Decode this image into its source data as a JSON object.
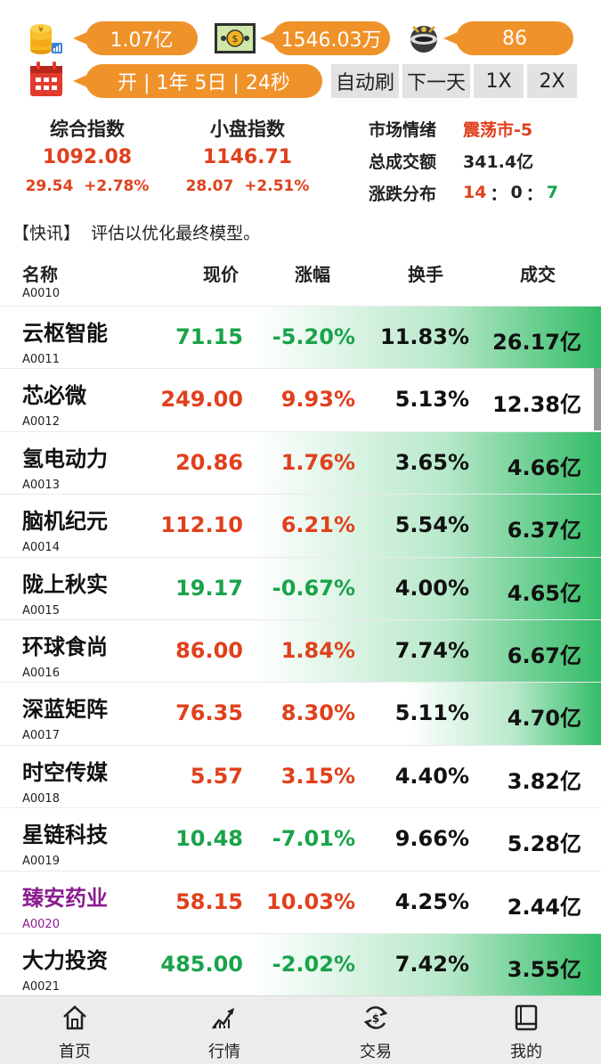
{
  "status": {
    "cash": "1.07亿",
    "assets": "1546.03万",
    "score": "86",
    "session": "开 | 1年 5日 | 24秒"
  },
  "controls": {
    "auto_refresh": "自动刷",
    "next_day": "下一天",
    "speed_1x": "1X",
    "speed_2x": "2X"
  },
  "indices": [
    {
      "name": "综合指数",
      "value": "1092.08",
      "change": "29.54",
      "pct": "+2.78%"
    },
    {
      "name": "小盘指数",
      "value": "1146.71",
      "change": "28.07",
      "pct": "+2.51%"
    }
  ],
  "market": {
    "sentiment_label": "市场情绪",
    "sentiment_value": "震荡市-5",
    "volume_label": "总成交额",
    "volume_value": "341.4亿",
    "dist_label": "涨跌分布",
    "dist_up": "14",
    "dist_flat": "0",
    "dist_down": "7",
    "dist_sep1": "：",
    "dist_sep2": "："
  },
  "news": {
    "tag": "【快讯】",
    "text": "评估以优化最终模型。"
  },
  "table": {
    "headers": {
      "name": "名称",
      "price": "现价",
      "change": "涨幅",
      "turnover": "换手",
      "volume": "成交"
    },
    "first_code": "A0010",
    "rows": [
      {
        "name": "云枢智能",
        "code": "A0011",
        "price": "71.15",
        "change": "-5.20%",
        "turnover": "11.83%",
        "volume": "26.17亿",
        "dir": "down",
        "bar_level": 0.58
      },
      {
        "name": "芯必微",
        "code": "A0012",
        "price": "249.00",
        "change": "9.93%",
        "turnover": "5.13%",
        "volume": "12.38亿",
        "dir": "up",
        "bar_level": 0
      },
      {
        "name": "氢电动力",
        "code": "A0013",
        "price": "20.86",
        "change": "1.76%",
        "turnover": "3.65%",
        "volume": "4.66亿",
        "dir": "up",
        "bar_level": 0.58
      },
      {
        "name": "脑机纪元",
        "code": "A0014",
        "price": "112.10",
        "change": "6.21%",
        "turnover": "5.54%",
        "volume": "6.37亿",
        "dir": "up",
        "bar_level": 0.58
      },
      {
        "name": "陇上秋实",
        "code": "A0015",
        "price": "19.17",
        "change": "-0.67%",
        "turnover": "4.00%",
        "volume": "4.65亿",
        "dir": "down",
        "bar_level": 0.58
      },
      {
        "name": "环球食尚",
        "code": "A0016",
        "price": "86.00",
        "change": "1.84%",
        "turnover": "7.74%",
        "volume": "6.67亿",
        "dir": "up",
        "bar_level": 0.58
      },
      {
        "name": "深蓝矩阵",
        "code": "A0017",
        "price": "76.35",
        "change": "8.30%",
        "turnover": "5.11%",
        "volume": "4.70亿",
        "dir": "up",
        "bar_level": 0.32
      },
      {
        "name": "时空传媒",
        "code": "A0018",
        "price": "5.57",
        "change": "3.15%",
        "turnover": "4.40%",
        "volume": "3.82亿",
        "dir": "up",
        "bar_level": 0
      },
      {
        "name": "星链科技",
        "code": "A0019",
        "price": "10.48",
        "change": "-7.01%",
        "turnover": "9.66%",
        "volume": "5.28亿",
        "dir": "down",
        "bar_level": 0
      },
      {
        "name": "臻安药业",
        "code": "A0020",
        "price": "58.15",
        "change": "10.03%",
        "turnover": "4.25%",
        "volume": "2.44亿",
        "dir": "up",
        "bar_level": 0,
        "highlight": true
      },
      {
        "name": "大力投资",
        "code": "A0021",
        "price": "485.00",
        "change": "-2.02%",
        "turnover": "7.42%",
        "volume": "3.55亿",
        "dir": "down",
        "bar_level": 0.58
      }
    ]
  },
  "nav": [
    {
      "label": "首页",
      "icon": "home-icon"
    },
    {
      "label": "行情",
      "icon": "trend-chart-icon"
    },
    {
      "label": "交易",
      "icon": "exchange-icon"
    },
    {
      "label": "我的",
      "icon": "book-icon"
    }
  ],
  "colors": {
    "up": "#e0401c",
    "down": "#1aa34a",
    "accent": "#f0922a",
    "highlight": "#8b1c8f"
  }
}
